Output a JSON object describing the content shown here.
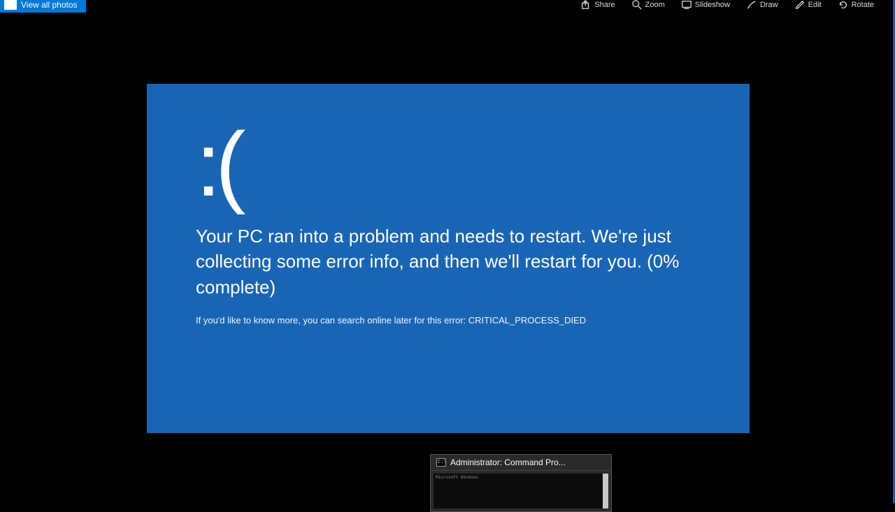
{
  "toolbar": {
    "view_all": "View all photos",
    "actions": [
      "Share",
      "Zoom",
      "Slideshow",
      "Draw",
      "Edit",
      "Rotate"
    ]
  },
  "bsod": {
    "face": ":(",
    "message": "Your PC ran into a problem and needs to restart. We're just collecting some error info, and then we'll restart for you. (0% complete)",
    "detail": "If you'd like to know more, you can search online later for this error: CRITICAL_PROCESS_DIED"
  },
  "cmd": {
    "title": "Administrator: Command Pro...",
    "icon_glyph": "C:\\",
    "body_hint": "Microsoft Windows"
  },
  "colors": {
    "accent": "#0078d7",
    "bsod_bg": "#1965b5"
  }
}
